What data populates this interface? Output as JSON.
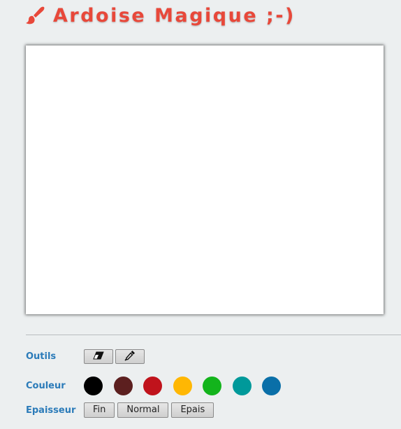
{
  "app": {
    "title": "Ardoise Magique ;-)",
    "title_icon": "paintbrush-icon",
    "accent_color": "#e8483a"
  },
  "toolbar": {
    "tools": {
      "label": "Outils",
      "items": [
        {
          "name": "eraser",
          "icon": "eraser-icon"
        },
        {
          "name": "color-picker",
          "icon": "eyedropper-icon"
        }
      ]
    },
    "colors": {
      "label": "Couleur",
      "swatches": [
        "#000000",
        "#5c1f1f",
        "#c0131c",
        "#ffb703",
        "#13b41c",
        "#00999a",
        "#0a6fa8"
      ]
    },
    "thickness": {
      "label": "Epaisseur",
      "options": [
        "Fin",
        "Normal",
        "Epais"
      ]
    }
  }
}
